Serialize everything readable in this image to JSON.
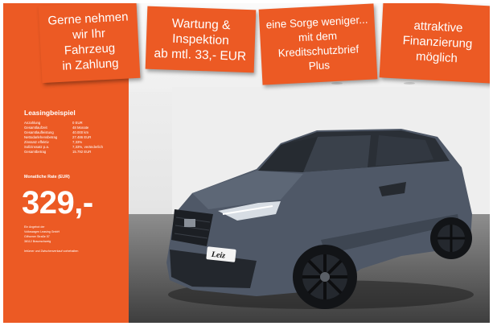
{
  "banners": [
    {
      "text": "Gerne nehmen\nwir Ihr\nFahrzeug\nin Zahlung"
    },
    {
      "text": "Wartung &\nInspektion\nab mtl. 33,- EUR"
    },
    {
      "text": "eine Sorge weniger...\nmit dem\nKreditschutzbrief\nPlus"
    },
    {
      "text": "attraktive\nFinanzierung\nmöglich"
    }
  ],
  "leasing": {
    "title": "Leasingbeispiel",
    "rows": [
      {
        "label": "Anzahlung",
        "value": "0 EUR"
      },
      {
        "label": "Gesamtlaufzeit",
        "value": "48 Monate"
      },
      {
        "label": "Gesamtlaufleistung",
        "value": "40.000 km"
      },
      {
        "label": "Nettodarlehensbetrag",
        "value": "27.486 EUR"
      },
      {
        "label": "Zinssatz effektiv",
        "value": "7,33%"
      },
      {
        "label": "Sollzinssatz p.a.",
        "value": "7,33%, veränderlich"
      },
      {
        "label": "Gesamtbetrag",
        "value": "15.792 EUR"
      }
    ],
    "rate_label": "Monatliche Rate (EUR)",
    "price": "329,-",
    "offer_lines": [
      "Ein Angebot der",
      "Volkswagen Leasing GmbH",
      "Gifhorner Straße 57",
      "38112 Braunschweig"
    ],
    "note": "Irrtümer und Zwischenverkauf vorbehalten"
  },
  "plate": {
    "text": "Leiz"
  },
  "colors": {
    "accent": "#ec5a24",
    "car_body": "#4f5867"
  }
}
